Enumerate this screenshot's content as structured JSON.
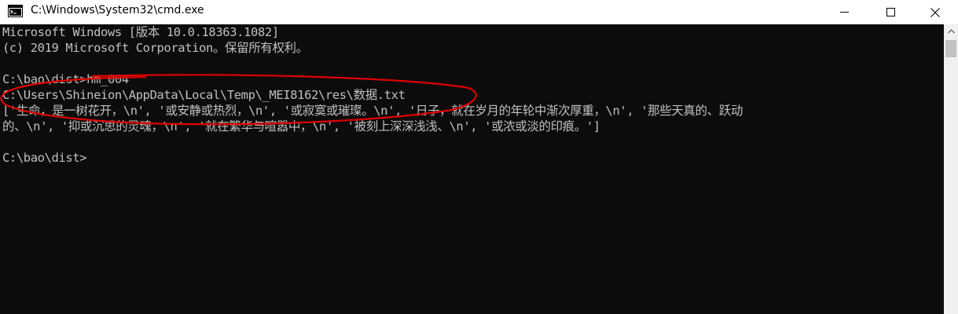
{
  "window": {
    "title": "C:\\Windows\\System32\\cmd.exe",
    "icon": "cmd-app-icon",
    "controls": {
      "minimize": "minimize-icon",
      "maximize": "maximize-icon",
      "close": "close-icon"
    }
  },
  "console": {
    "lines": [
      "Microsoft Windows [版本 10.0.18363.1082]",
      "(c) 2019 Microsoft Corporation。保留所有权利。",
      "",
      "C:\\bao\\dist>hm_004",
      "C:\\Users\\Shineion\\AppData\\Local\\Temp\\_MEI8162\\res\\数据.txt",
      "['生命，是一树花开，\\n', '或安静或热烈，\\n', '或寂寞或璀璨。\\n', '日子，就在岁月的年轮中渐次厚重，\\n', '那些天真的、跃动",
      "的、\\n', '抑或沉思的灵魂，\\n', '就在繁华与喧嚣中，\\n', '被刻上深深浅浅、\\n', '或浓或淡的印痕。']",
      "",
      "C:\\bao\\dist>"
    ]
  },
  "colors": {
    "console_bg": "#0c0c0c",
    "console_text": "#c0c0c0",
    "annotation": "#e00000"
  }
}
